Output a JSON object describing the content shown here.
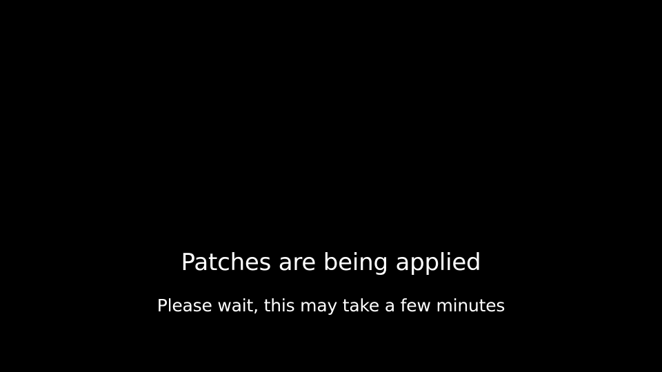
{
  "screen": {
    "background_color": "#000000",
    "text_color": "#ffffff"
  },
  "status": {
    "headline": "Patches are being applied",
    "subline": "Please wait, this may take a few minutes"
  }
}
